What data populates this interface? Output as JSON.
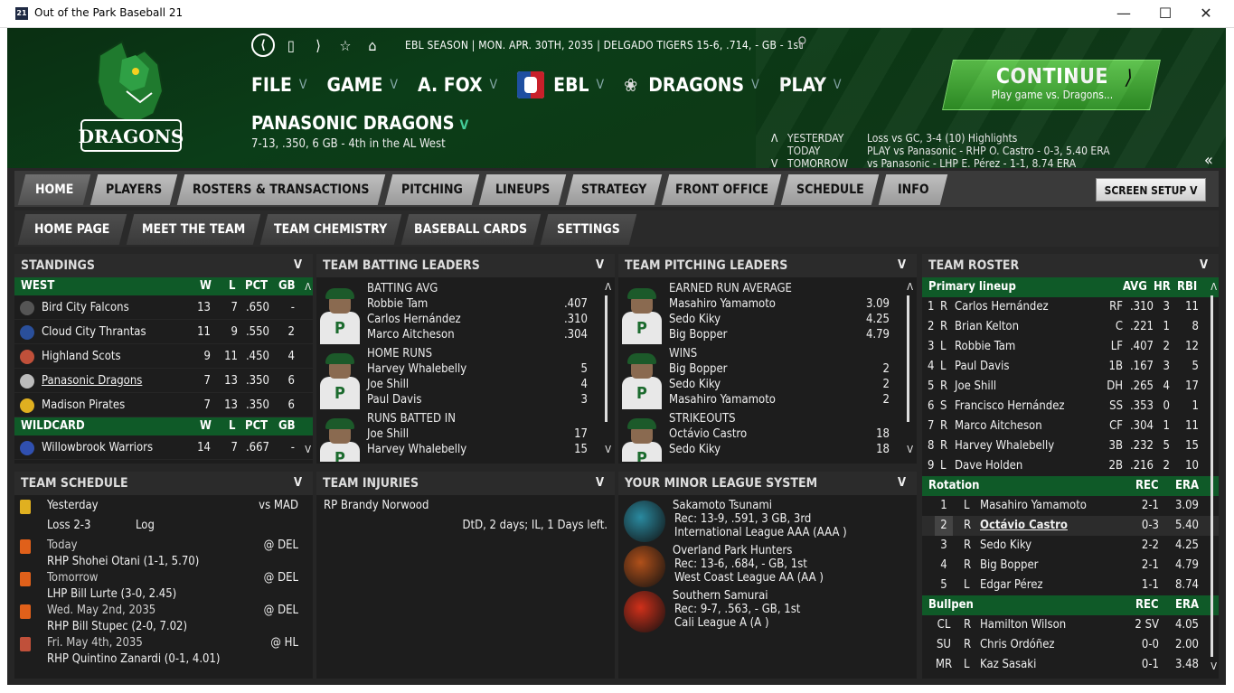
{
  "window": {
    "title": "Out of the Park Baseball 21",
    "app_icon": "21"
  },
  "header": {
    "season_info": "EBL SEASON  |  MON. APR. 30TH, 2035  |  DELGADO TIGERS  15-6, .714, - GB - 1st",
    "menus": [
      {
        "label": "FILE"
      },
      {
        "label": "GAME"
      },
      {
        "label": "A. FOX"
      },
      {
        "label": "EBL"
      },
      {
        "label": "DRAGONS"
      },
      {
        "label": "PLAY"
      }
    ],
    "continue_title": "CONTINUE",
    "continue_sub": "Play game vs. Dragons...",
    "team_name": "PANASONIC DRAGONS",
    "team_record": "7-13, .350, 6 GB - 4th in the AL West",
    "logo_text": "DRAGONS",
    "yesterday_label": "YESTERDAY",
    "yesterday_value": "Loss vs GC, 3-4 (10)    Highlights",
    "today_label": "TODAY",
    "today_value": "PLAY vs Panasonic - RHP O. Castro - 0-3, 5.40 ERA",
    "tomorrow_label": "TOMORROW",
    "tomorrow_value": "vs Panasonic - LHP E. Pérez - 1-1, 8.74 ERA"
  },
  "tabs": [
    "HOME",
    "PLAYERS",
    "ROSTERS & TRANSACTIONS",
    "PITCHING",
    "LINEUPS",
    "STRATEGY",
    "FRONT OFFICE",
    "SCHEDULE",
    "INFO"
  ],
  "screen_setup": "SCREEN SETUP",
  "subtabs": [
    "HOME PAGE",
    "MEET THE TEAM",
    "TEAM CHEMISTRY",
    "BASEBALL CARDS",
    "SETTINGS"
  ],
  "standings": {
    "title": "STANDINGS",
    "west_label": "WEST",
    "cols": [
      "W",
      "L",
      "PCT",
      "GB"
    ],
    "west": [
      {
        "team": "Bird City Falcons",
        "w": "13",
        "l": "7",
        "pct": ".650",
        "gb": "-",
        "color": "#555"
      },
      {
        "team": "Cloud City Thrantas",
        "w": "11",
        "l": "9",
        "pct": ".550",
        "gb": "2",
        "color": "#2a4f9a"
      },
      {
        "team": "Highland Scots",
        "w": "9",
        "l": "11",
        "pct": ".450",
        "gb": "4",
        "color": "#c0503a"
      },
      {
        "team": "Panasonic Dragons",
        "w": "7",
        "l": "13",
        "pct": ".350",
        "gb": "6",
        "color": "#bbb"
      },
      {
        "team": "Madison Pirates",
        "w": "7",
        "l": "13",
        "pct": ".350",
        "gb": "6",
        "color": "#e0b020"
      }
    ],
    "wild_label": "WILDCARD",
    "wild": [
      {
        "team": "Willowbrook Warriors",
        "w": "14",
        "l": "7",
        "pct": ".667",
        "gb": "-",
        "color": "#3050b0"
      }
    ]
  },
  "batting": {
    "title": "TEAM BATTING LEADERS",
    "sections": [
      {
        "cat": "BATTING AVG",
        "rows": [
          {
            "name": "Robbie Tam",
            "val": ".407"
          },
          {
            "name": "Carlos Hernández",
            "val": ".310"
          },
          {
            "name": "Marco Aitcheson",
            "val": ".304"
          }
        ]
      },
      {
        "cat": "HOME RUNS",
        "rows": [
          {
            "name": "Harvey Whalebelly",
            "val": "5"
          },
          {
            "name": "Joe Shill",
            "val": "4"
          },
          {
            "name": "Paul Davis",
            "val": "3"
          }
        ]
      },
      {
        "cat": "RUNS BATTED IN",
        "rows": [
          {
            "name": "Joe Shill",
            "val": "17"
          },
          {
            "name": "Harvey Whalebelly",
            "val": "15"
          }
        ]
      }
    ]
  },
  "pitching": {
    "title": "TEAM PITCHING LEADERS",
    "sections": [
      {
        "cat": "EARNED RUN AVERAGE",
        "rows": [
          {
            "name": "Masahiro Yamamoto",
            "val": "3.09"
          },
          {
            "name": "Sedo Kiky",
            "val": "4.25"
          },
          {
            "name": "Big Bopper",
            "val": "4.79"
          }
        ]
      },
      {
        "cat": "WINS",
        "rows": [
          {
            "name": "Big Bopper",
            "val": "2"
          },
          {
            "name": "Sedo Kiky",
            "val": "2"
          },
          {
            "name": "Masahiro Yamamoto",
            "val": "2"
          }
        ]
      },
      {
        "cat": "STRIKEOUTS",
        "rows": [
          {
            "name": "Octávio Castro",
            "val": "18"
          },
          {
            "name": "Sedo Kiky",
            "val": "18"
          }
        ]
      }
    ]
  },
  "roster": {
    "title": "TEAM ROSTER",
    "lineup_label": "Primary lineup",
    "lineup_cols": [
      "AVG",
      "HR",
      "RBI"
    ],
    "lineup": [
      {
        "n": "1",
        "h": "R",
        "name": "Carlos Hernández",
        "pos": "RF",
        "avg": ".310",
        "hr": "3",
        "rbi": "11"
      },
      {
        "n": "2",
        "h": "R",
        "name": "Brian Kelton",
        "pos": "C",
        "avg": ".221",
        "hr": "1",
        "rbi": "8"
      },
      {
        "n": "3",
        "h": "L",
        "name": "Robbie Tam",
        "pos": "LF",
        "avg": ".407",
        "hr": "2",
        "rbi": "12"
      },
      {
        "n": "4",
        "h": "L",
        "name": "Paul Davis",
        "pos": "1B",
        "avg": ".167",
        "hr": "3",
        "rbi": "5"
      },
      {
        "n": "5",
        "h": "R",
        "name": "Joe Shill",
        "pos": "DH",
        "avg": ".265",
        "hr": "4",
        "rbi": "17"
      },
      {
        "n": "6",
        "h": "S",
        "name": "Francisco Hernández",
        "pos": "SS",
        "avg": ".353",
        "hr": "0",
        "rbi": "1"
      },
      {
        "n": "7",
        "h": "R",
        "name": "Marco Aitcheson",
        "pos": "CF",
        "avg": ".304",
        "hr": "1",
        "rbi": "11"
      },
      {
        "n": "8",
        "h": "R",
        "name": "Harvey Whalebelly",
        "pos": "3B",
        "avg": ".232",
        "hr": "5",
        "rbi": "15"
      },
      {
        "n": "9",
        "h": "L",
        "name": "Dave Holden",
        "pos": "2B",
        "avg": ".216",
        "hr": "2",
        "rbi": "10"
      }
    ],
    "rotation_label": "Rotation",
    "rotation_cols": [
      "REC",
      "ERA"
    ],
    "rotation": [
      {
        "n": "1",
        "h": "L",
        "name": "Masahiro Yamamoto",
        "rec": "2-1",
        "era": "3.09"
      },
      {
        "n": "2",
        "h": "R",
        "name": "Octávio Castro",
        "rec": "0-3",
        "era": "5.40"
      },
      {
        "n": "3",
        "h": "R",
        "name": "Sedo Kiky",
        "rec": "2-2",
        "era": "4.25"
      },
      {
        "n": "4",
        "h": "R",
        "name": "Big Bopper",
        "rec": "2-1",
        "era": "4.79"
      },
      {
        "n": "5",
        "h": "L",
        "name": "Edgar Pérez",
        "rec": "1-1",
        "era": "8.74"
      }
    ],
    "bullpen_label": "Bullpen",
    "bullpen": [
      {
        "n": "CL",
        "h": "R",
        "name": "Hamilton Wilson",
        "rec": "2 SV",
        "era": "4.05"
      },
      {
        "n": "SU",
        "h": "R",
        "name": "Chris Ordóñez",
        "rec": "0-0",
        "era": "2.00"
      },
      {
        "n": "MR",
        "h": "L",
        "name": "Kaz Sasaki",
        "rec": "0-1",
        "era": "3.48"
      }
    ]
  },
  "schedule": {
    "title": "TEAM SCHEDULE",
    "items": [
      {
        "day": "Yesterday",
        "opp": "vs MAD",
        "line2": "Loss 2-3",
        "extra": "Log",
        "color": "#e0b020"
      },
      {
        "day": "Today",
        "opp": "@ DEL",
        "line2": "RHP Shohei Otani (1-1, 5.70)",
        "extra": "",
        "color": "#e0601a"
      },
      {
        "day": "Tomorrow",
        "opp": "@ DEL",
        "line2": "LHP Bill Lurte (3-0, 2.45)",
        "extra": "",
        "color": "#e0601a"
      },
      {
        "day": "Wed. May 2nd, 2035",
        "opp": "@ DEL",
        "line2": "RHP Bill Stupec (2-0, 7.02)",
        "extra": "",
        "color": "#e0601a"
      },
      {
        "day": "Fri. May 4th, 2035",
        "opp": "@ HL",
        "line2": "RHP Quintino Zanardi (0-1, 4.01)",
        "extra": "",
        "color": "#c0503a"
      }
    ]
  },
  "injuries": {
    "title": "TEAM INJURIES",
    "player": "RP Brandy Norwood",
    "detail": "DtD, 2 days; IL, 1 Days left."
  },
  "minors": {
    "title": "YOUR MINOR LEAGUE SYSTEM",
    "teams": [
      {
        "name": "Sakamoto Tsunami",
        "rec": "Rec: 13-9, .591, 3 GB, 3rd",
        "league": "International League AAA (AAA )",
        "color": "#2a8aa0"
      },
      {
        "name": "Overland Park Hunters",
        "rec": "Rec: 13-6, .684, - GB, 1st",
        "league": "West Coast League AA (AA )",
        "color": "#b0501a"
      },
      {
        "name": "Southern Samurai",
        "rec": "Rec: 9-7, .563, - GB, 1st",
        "league": "Cali League A (A )",
        "color": "#d0301a"
      }
    ]
  }
}
